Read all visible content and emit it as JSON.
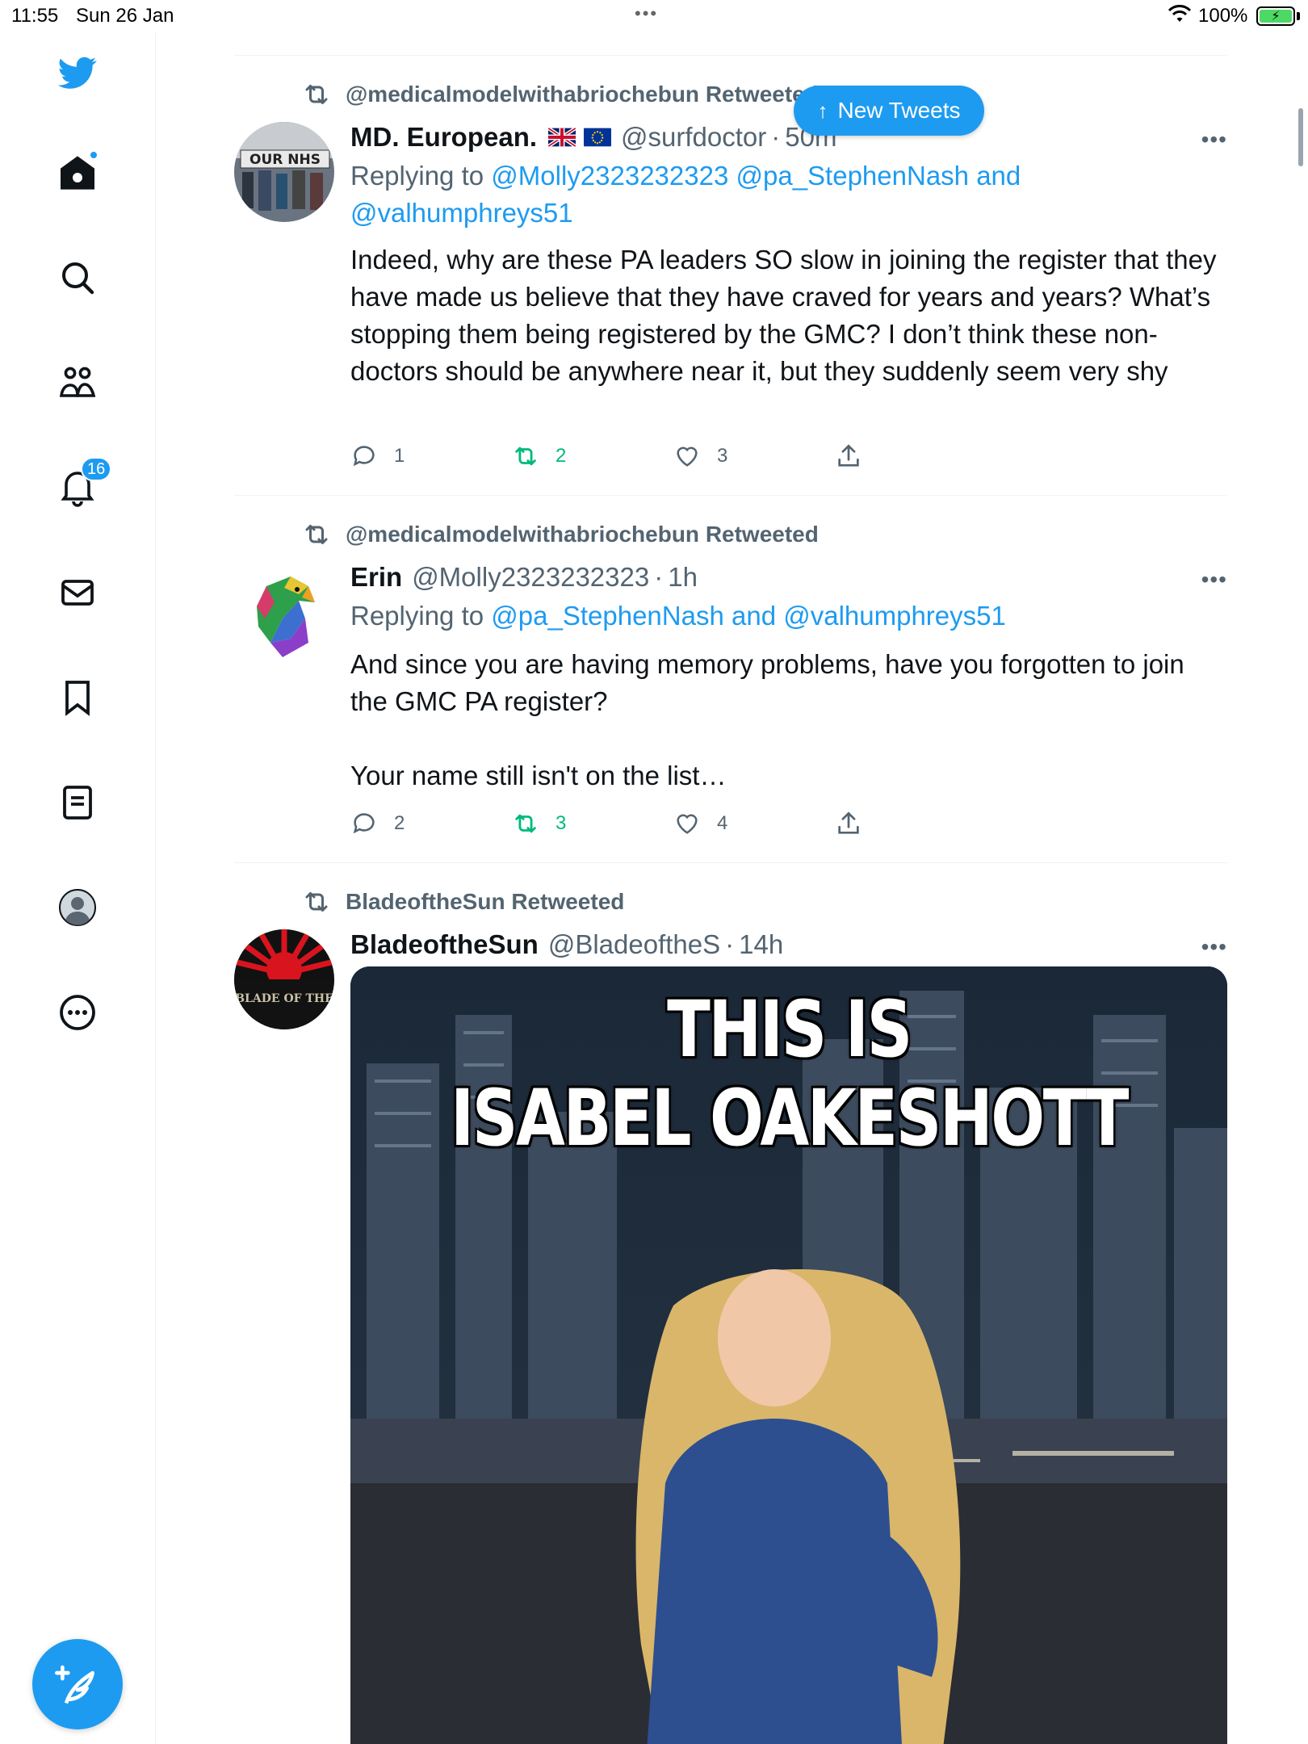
{
  "status_bar": {
    "time": "11:55",
    "date": "Sun 26 Jan",
    "dots": "•••",
    "battery": "100%"
  },
  "sidebar": {
    "items": [
      {
        "icon": "twitter-logo-icon"
      },
      {
        "icon": "home-icon"
      },
      {
        "icon": "search-icon"
      },
      {
        "icon": "communities-icon"
      },
      {
        "icon": "notifications-icon",
        "badge": "16"
      },
      {
        "icon": "messages-icon"
      },
      {
        "icon": "bookmarks-icon"
      },
      {
        "icon": "lists-icon"
      },
      {
        "icon": "profile-icon"
      },
      {
        "icon": "more-icon"
      }
    ],
    "compose": {
      "icon": "compose-tweet-icon"
    }
  },
  "new_tweets": {
    "label": "New Tweets"
  },
  "tweets": [
    {
      "retweeted_by": "@medicalmodelwithabriochebun Retweeted",
      "name": "MD. European.",
      "flags": [
        "uk-flag",
        "eu-flag"
      ],
      "handle": "@surfdoctor",
      "sep": "·",
      "time": "50m",
      "more": "•••",
      "replying_prefix": "Replying to",
      "replying_links": "@Molly2323232323 @pa_StephenNash and @valhumphreys51",
      "text": "Indeed, why are these PA leaders SO slow in joining the register that they have made us believe that they have craved for years and years? What’s stopping them being registered by the GMC? I don’t think these non-doctors should be anywhere near it, but they suddenly seem very shy",
      "replies": "1",
      "retweets": "2",
      "likes": "3"
    },
    {
      "retweeted_by": "@medicalmodelwithabriochebun Retweeted",
      "name": "Erin",
      "handle": "@Molly2323232323",
      "sep": "·",
      "time": "1h",
      "more": "•••",
      "replying_prefix": "Replying to",
      "replying_links": "@pa_StephenNash and @valhumphreys51",
      "text": "And since you are having memory problems, have you forgotten to join the GMC PA register?\n\nYour name still isn't on the list…",
      "replies": "2",
      "retweets": "3",
      "likes": "4"
    },
    {
      "retweeted_by": "BladeoftheSun Retweeted",
      "name": "BladeoftheSun",
      "handle": "@BladeoftheS",
      "sep": "·",
      "time": "14h",
      "more": "•••",
      "media_text_line1": "THIS IS",
      "media_text_line2": "ISABEL OAKESHOTT"
    }
  ],
  "avatar_texts": {
    "nhs_sign": "OUR NHS",
    "blade_text": "BLADE OF THE"
  }
}
